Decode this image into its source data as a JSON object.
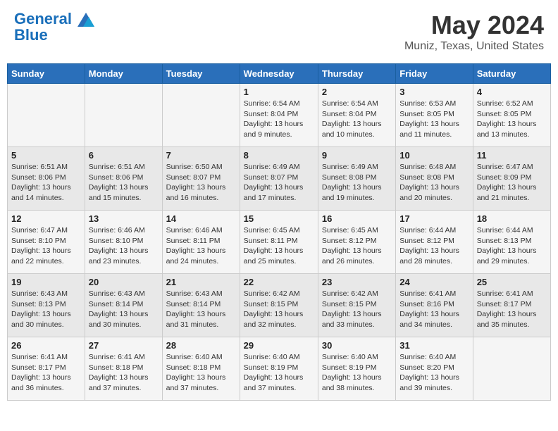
{
  "header": {
    "logo_line1": "General",
    "logo_line2": "Blue",
    "month_year": "May 2024",
    "location": "Muniz, Texas, United States"
  },
  "days_of_week": [
    "Sunday",
    "Monday",
    "Tuesday",
    "Wednesday",
    "Thursday",
    "Friday",
    "Saturday"
  ],
  "weeks": [
    [
      {
        "day": "",
        "info": ""
      },
      {
        "day": "",
        "info": ""
      },
      {
        "day": "",
        "info": ""
      },
      {
        "day": "1",
        "info": "Sunrise: 6:54 AM\nSunset: 8:04 PM\nDaylight: 13 hours\nand 9 minutes."
      },
      {
        "day": "2",
        "info": "Sunrise: 6:54 AM\nSunset: 8:04 PM\nDaylight: 13 hours\nand 10 minutes."
      },
      {
        "day": "3",
        "info": "Sunrise: 6:53 AM\nSunset: 8:05 PM\nDaylight: 13 hours\nand 11 minutes."
      },
      {
        "day": "4",
        "info": "Sunrise: 6:52 AM\nSunset: 8:05 PM\nDaylight: 13 hours\nand 13 minutes."
      }
    ],
    [
      {
        "day": "5",
        "info": "Sunrise: 6:51 AM\nSunset: 8:06 PM\nDaylight: 13 hours\nand 14 minutes."
      },
      {
        "day": "6",
        "info": "Sunrise: 6:51 AM\nSunset: 8:06 PM\nDaylight: 13 hours\nand 15 minutes."
      },
      {
        "day": "7",
        "info": "Sunrise: 6:50 AM\nSunset: 8:07 PM\nDaylight: 13 hours\nand 16 minutes."
      },
      {
        "day": "8",
        "info": "Sunrise: 6:49 AM\nSunset: 8:07 PM\nDaylight: 13 hours\nand 17 minutes."
      },
      {
        "day": "9",
        "info": "Sunrise: 6:49 AM\nSunset: 8:08 PM\nDaylight: 13 hours\nand 19 minutes."
      },
      {
        "day": "10",
        "info": "Sunrise: 6:48 AM\nSunset: 8:08 PM\nDaylight: 13 hours\nand 20 minutes."
      },
      {
        "day": "11",
        "info": "Sunrise: 6:47 AM\nSunset: 8:09 PM\nDaylight: 13 hours\nand 21 minutes."
      }
    ],
    [
      {
        "day": "12",
        "info": "Sunrise: 6:47 AM\nSunset: 8:10 PM\nDaylight: 13 hours\nand 22 minutes."
      },
      {
        "day": "13",
        "info": "Sunrise: 6:46 AM\nSunset: 8:10 PM\nDaylight: 13 hours\nand 23 minutes."
      },
      {
        "day": "14",
        "info": "Sunrise: 6:46 AM\nSunset: 8:11 PM\nDaylight: 13 hours\nand 24 minutes."
      },
      {
        "day": "15",
        "info": "Sunrise: 6:45 AM\nSunset: 8:11 PM\nDaylight: 13 hours\nand 25 minutes."
      },
      {
        "day": "16",
        "info": "Sunrise: 6:45 AM\nSunset: 8:12 PM\nDaylight: 13 hours\nand 26 minutes."
      },
      {
        "day": "17",
        "info": "Sunrise: 6:44 AM\nSunset: 8:12 PM\nDaylight: 13 hours\nand 28 minutes."
      },
      {
        "day": "18",
        "info": "Sunrise: 6:44 AM\nSunset: 8:13 PM\nDaylight: 13 hours\nand 29 minutes."
      }
    ],
    [
      {
        "day": "19",
        "info": "Sunrise: 6:43 AM\nSunset: 8:13 PM\nDaylight: 13 hours\nand 30 minutes."
      },
      {
        "day": "20",
        "info": "Sunrise: 6:43 AM\nSunset: 8:14 PM\nDaylight: 13 hours\nand 30 minutes."
      },
      {
        "day": "21",
        "info": "Sunrise: 6:43 AM\nSunset: 8:14 PM\nDaylight: 13 hours\nand 31 minutes."
      },
      {
        "day": "22",
        "info": "Sunrise: 6:42 AM\nSunset: 8:15 PM\nDaylight: 13 hours\nand 32 minutes."
      },
      {
        "day": "23",
        "info": "Sunrise: 6:42 AM\nSunset: 8:15 PM\nDaylight: 13 hours\nand 33 minutes."
      },
      {
        "day": "24",
        "info": "Sunrise: 6:41 AM\nSunset: 8:16 PM\nDaylight: 13 hours\nand 34 minutes."
      },
      {
        "day": "25",
        "info": "Sunrise: 6:41 AM\nSunset: 8:17 PM\nDaylight: 13 hours\nand 35 minutes."
      }
    ],
    [
      {
        "day": "26",
        "info": "Sunrise: 6:41 AM\nSunset: 8:17 PM\nDaylight: 13 hours\nand 36 minutes."
      },
      {
        "day": "27",
        "info": "Sunrise: 6:41 AM\nSunset: 8:18 PM\nDaylight: 13 hours\nand 37 minutes."
      },
      {
        "day": "28",
        "info": "Sunrise: 6:40 AM\nSunset: 8:18 PM\nDaylight: 13 hours\nand 37 minutes."
      },
      {
        "day": "29",
        "info": "Sunrise: 6:40 AM\nSunset: 8:19 PM\nDaylight: 13 hours\nand 37 minutes."
      },
      {
        "day": "30",
        "info": "Sunrise: 6:40 AM\nSunset: 8:19 PM\nDaylight: 13 hours\nand 38 minutes."
      },
      {
        "day": "31",
        "info": "Sunrise: 6:40 AM\nSunset: 8:20 PM\nDaylight: 13 hours\nand 39 minutes."
      },
      {
        "day": "",
        "info": ""
      }
    ]
  ]
}
